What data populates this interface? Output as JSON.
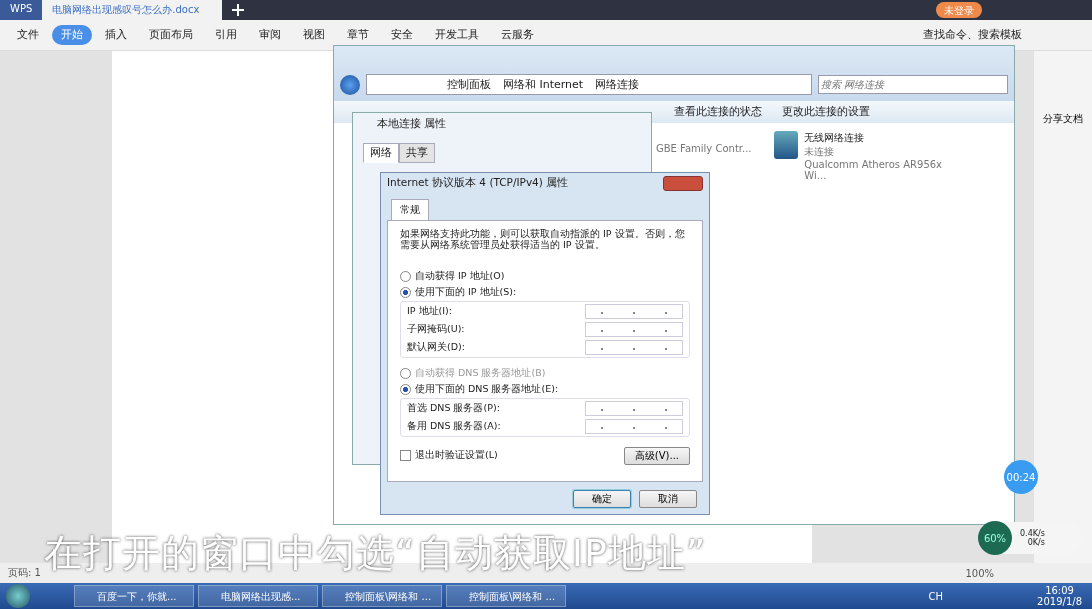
{
  "app_tabs": [
    {
      "label": "WPS",
      "selected": false
    },
    {
      "label": "电脑网络出现感叹号怎么办.docx",
      "selected": true
    }
  ],
  "login_button": "未登录",
  "menu": [
    {
      "label": "文件",
      "selected": false
    },
    {
      "label": "开始",
      "selected": true
    },
    {
      "label": "插入",
      "selected": false
    },
    {
      "label": "页面布局",
      "selected": false
    },
    {
      "label": "引用",
      "selected": false
    },
    {
      "label": "审阅",
      "selected": false
    },
    {
      "label": "视图",
      "selected": false
    },
    {
      "label": "章节",
      "selected": false
    },
    {
      "label": "安全",
      "selected": false
    },
    {
      "label": "开发工具",
      "selected": false
    },
    {
      "label": "云服务",
      "selected": false
    }
  ],
  "command_search": "查找命令、搜索模板",
  "share_button": "分享文档",
  "explorer": {
    "breadcrumb": [
      "控制面板",
      "网络和 Internet",
      "网络连接"
    ],
    "search_placeholder": "搜索 网络连接",
    "toolbar": [
      "查看此连接的状态",
      "更改此连接的设置"
    ],
    "adapters": [
      {
        "device": "GBE Family Contr..."
      },
      {
        "name": "无线网络连接",
        "status": "未连接",
        "device": "Qualcomm Atheros AR956x Wi..."
      }
    ]
  },
  "local_props": {
    "title": "本地连接 属性",
    "tabs": [
      {
        "label": "网络",
        "selected": true
      },
      {
        "label": "共享",
        "selected": false
      }
    ]
  },
  "ipv4": {
    "title": "Internet 协议版本 4 (TCP/IPv4) 属性",
    "tab": "常规",
    "intro": "如果网络支持此功能，则可以获取自动指派的 IP 设置。否则，您需要从网络系统管理员处获得适当的 IP 设置。",
    "ip_options": [
      {
        "label": "自动获得 IP 地址(O)",
        "selected": false
      },
      {
        "label": "使用下面的 IP 地址(S):",
        "selected": true
      }
    ],
    "ip_fields": [
      "IP 地址(I):",
      "子网掩码(U):",
      "默认网关(D):"
    ],
    "dns_options": [
      {
        "label": "自动获得 DNS 服务器地址(B)",
        "selected": false,
        "disabled": true
      },
      {
        "label": "使用下面的 DNS 服务器地址(E):",
        "selected": true,
        "disabled": false
      }
    ],
    "dns_fields": [
      "首选 DNS 服务器(P):",
      "备用 DNS 服务器(A):"
    ],
    "validate": {
      "label": "退出时验证设置(L)",
      "checked": false
    },
    "advanced": "高级(V)...",
    "ok": "确定",
    "cancel": "取消"
  },
  "timer": "00:24",
  "net_widget": {
    "percent": "60%",
    "up": "0.4K/s",
    "down": "0K/s"
  },
  "status_bar": {
    "page": "页码: 1",
    "zoom": "100%"
  },
  "subtitle": "在打开的窗口中勾选“自动获取IP地址”",
  "taskbar": [
    "百度一下，你就...",
    "电脑网络出现感...",
    "控制面板\\网络和 ...",
    "控制面板\\网络和 ..."
  ],
  "tray": {
    "lang": "CH",
    "time": "16:09",
    "date": "2019/1/8"
  }
}
